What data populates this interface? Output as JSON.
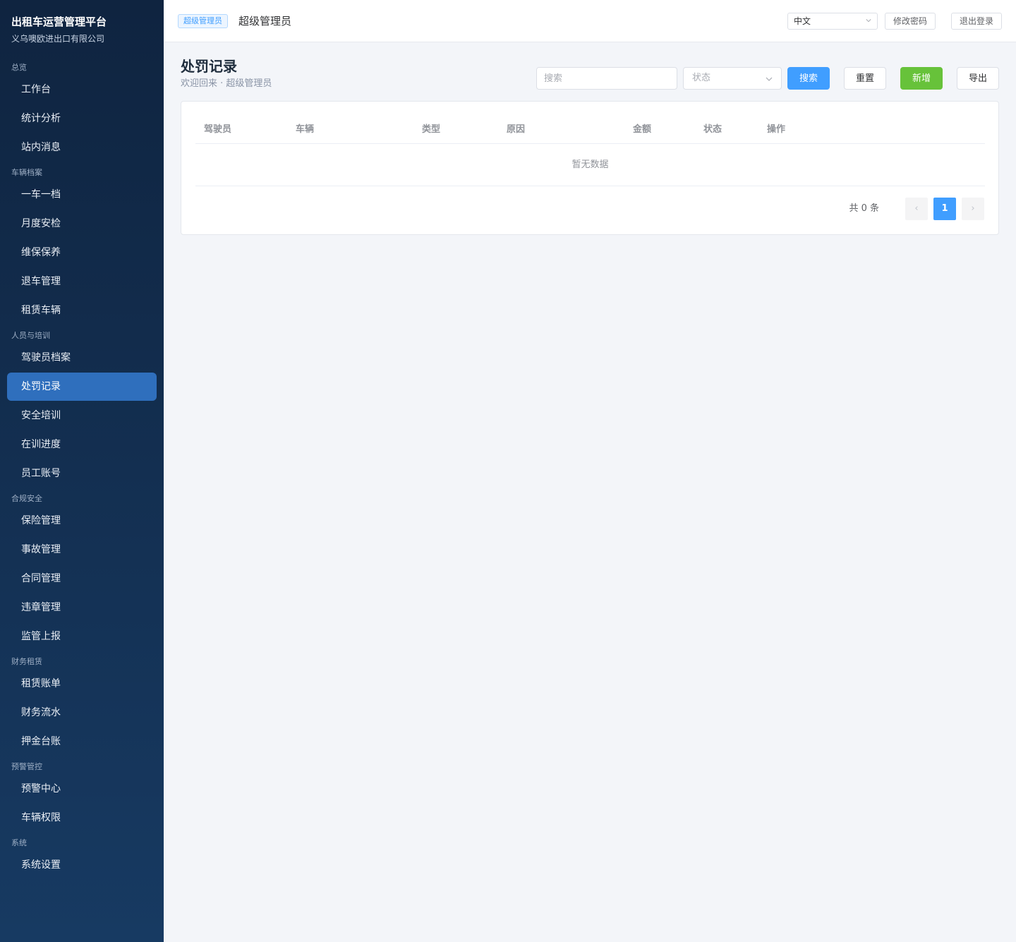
{
  "brand": {
    "title": "出租车运营管理平台",
    "subtitle": "义乌噢欧进出口有限公司"
  },
  "sidebar": {
    "groups": [
      {
        "title": "总览",
        "items": [
          "工作台",
          "统计分析",
          "站内消息"
        ]
      },
      {
        "title": "车辆档案",
        "items": [
          "一车一档",
          "月度安检",
          "维保保养",
          "退车管理",
          "租赁车辆"
        ]
      },
      {
        "title": "人员与培训",
        "items": [
          "驾驶员档案",
          "处罚记录",
          "安全培训",
          "在训进度",
          "员工账号"
        ]
      },
      {
        "title": "合规安全",
        "items": [
          "保险管理",
          "事故管理",
          "合同管理",
          "违章管理",
          "监管上报"
        ]
      },
      {
        "title": "财务租赁",
        "items": [
          "租赁账单",
          "财务流水",
          "押金台账"
        ]
      },
      {
        "title": "预警管控",
        "items": [
          "预警中心",
          "车辆权限"
        ]
      },
      {
        "title": "系统",
        "items": [
          "系统设置"
        ]
      }
    ],
    "active_item": "处罚记录"
  },
  "header": {
    "role_tag": "超级管理员",
    "user_name": "超级管理员",
    "language": "中文",
    "change_password": "修改密码",
    "logout": "退出登录"
  },
  "page": {
    "title": "处罚记录",
    "subtitle": "欢迎回来 · 超级管理员"
  },
  "toolbar": {
    "search_placeholder": "搜索",
    "status_placeholder": "状态",
    "search_label": "搜索",
    "reset_label": "重置",
    "add_label": "新增",
    "export_label": "导出"
  },
  "table": {
    "columns": [
      "驾驶员",
      "车辆",
      "类型",
      "原因",
      "金额",
      "状态",
      "操作"
    ],
    "empty_text": "暂无数据"
  },
  "pagination": {
    "total_text": "共 0 条",
    "current_page": "1",
    "prev": "‹",
    "next": "›"
  },
  "colors": {
    "sidebar_top": "#0f2440",
    "sidebar_bottom": "#173a62",
    "active_item": "#2f6fbd",
    "primary": "#409eff",
    "success": "#67c23a"
  }
}
